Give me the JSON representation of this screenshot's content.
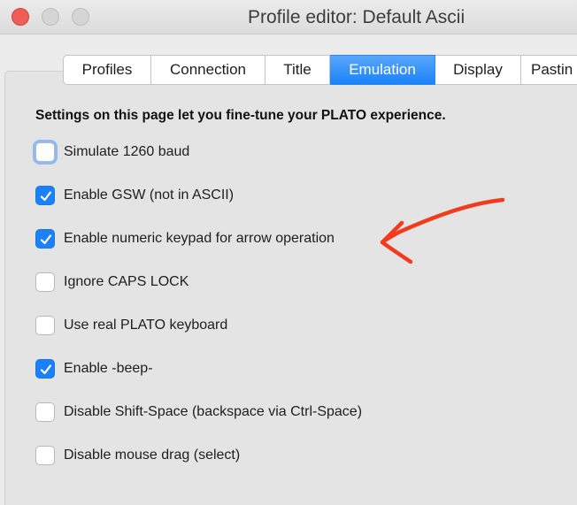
{
  "window": {
    "title": "Profile editor: Default Ascii"
  },
  "tabs": [
    {
      "label": "Profiles",
      "active": false
    },
    {
      "label": "Connection",
      "active": false
    },
    {
      "label": "Title",
      "active": false
    },
    {
      "label": "Emulation",
      "active": true
    },
    {
      "label": "Display",
      "active": false
    },
    {
      "label": "Pastin",
      "active": false
    }
  ],
  "page": {
    "heading": "Settings on this page let you fine-tune your PLATO experience."
  },
  "options": [
    {
      "label": "Simulate 1260 baud",
      "checked": false,
      "focused": true
    },
    {
      "label": "Enable GSW (not in ASCII)",
      "checked": true,
      "focused": false
    },
    {
      "label": "Enable numeric keypad for arrow operation",
      "checked": true,
      "focused": false
    },
    {
      "label": "Ignore CAPS LOCK",
      "checked": false,
      "focused": false
    },
    {
      "label": "Use real PLATO keyboard",
      "checked": false,
      "focused": false
    },
    {
      "label": "Enable -beep-",
      "checked": true,
      "focused": false
    },
    {
      "label": "Disable Shift-Space (backspace via Ctrl-Space)",
      "checked": false,
      "focused": false
    },
    {
      "label": "Disable mouse drag (select)",
      "checked": false,
      "focused": false
    }
  ],
  "colors": {
    "accent": "#1c80f7",
    "annotation": "#f23a1c",
    "close_button": "#ee5e56"
  },
  "icons": {
    "annotation": "red-hand-drawn-arrow-icon",
    "check": "checkmark-icon"
  }
}
